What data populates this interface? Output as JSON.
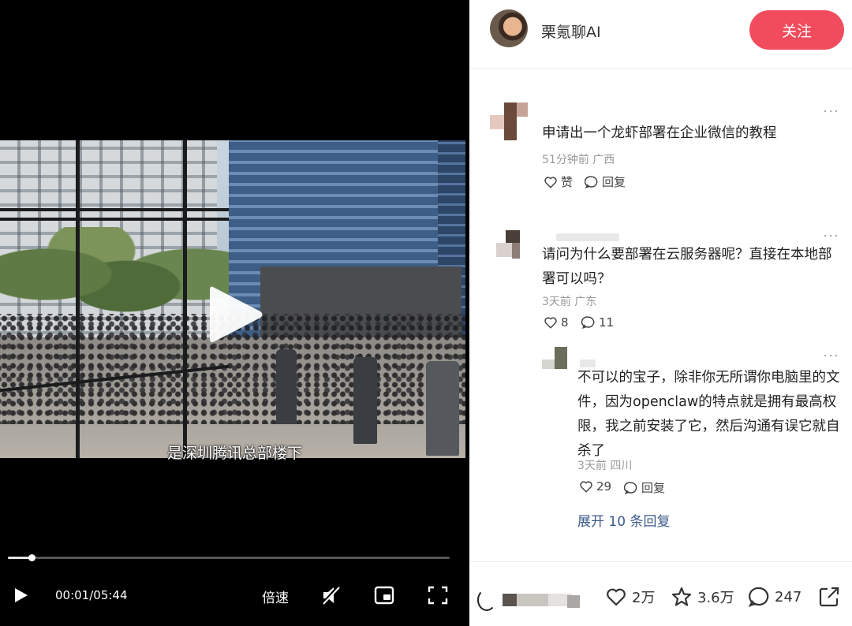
{
  "video": {
    "subtitle": "是深圳腾讯总部楼下",
    "time": "00:01/05:44",
    "progress": 0.003,
    "speed_label": "倍速"
  },
  "author": {
    "name": "栗氪聊AI",
    "follow_label": "关注"
  },
  "comments": [
    {
      "text": "申请出一个龙虾部署在企业微信的教程",
      "meta": "51分钟前 广西",
      "like_label": "赞",
      "reply_label": "回复"
    },
    {
      "text_lines": [
        "请问为什么要部署在云服务器呢？直接在本地部",
        "署可以吗？"
      ],
      "meta": "3天前 广东",
      "like_count": "8",
      "reply_count": "11"
    },
    {
      "text_lines": [
        "不可以的宝子，除非你无所谓你电脑里的文",
        "件，因为openclaw的特点就是拥有最高权",
        "限，我之前安装了它，然后沟通有误它就自",
        "杀了"
      ],
      "meta": "3天前 四川",
      "like_count": "29",
      "reply_label": "回复"
    }
  ],
  "expand_replies": "展开 10 条回复",
  "more_glyph": "···",
  "stats": {
    "likes": "2万",
    "favorites": "3.6万",
    "comments": "247"
  },
  "colors": {
    "follow_button": "#f04c5d",
    "expand_link": "#3d5a8a"
  }
}
